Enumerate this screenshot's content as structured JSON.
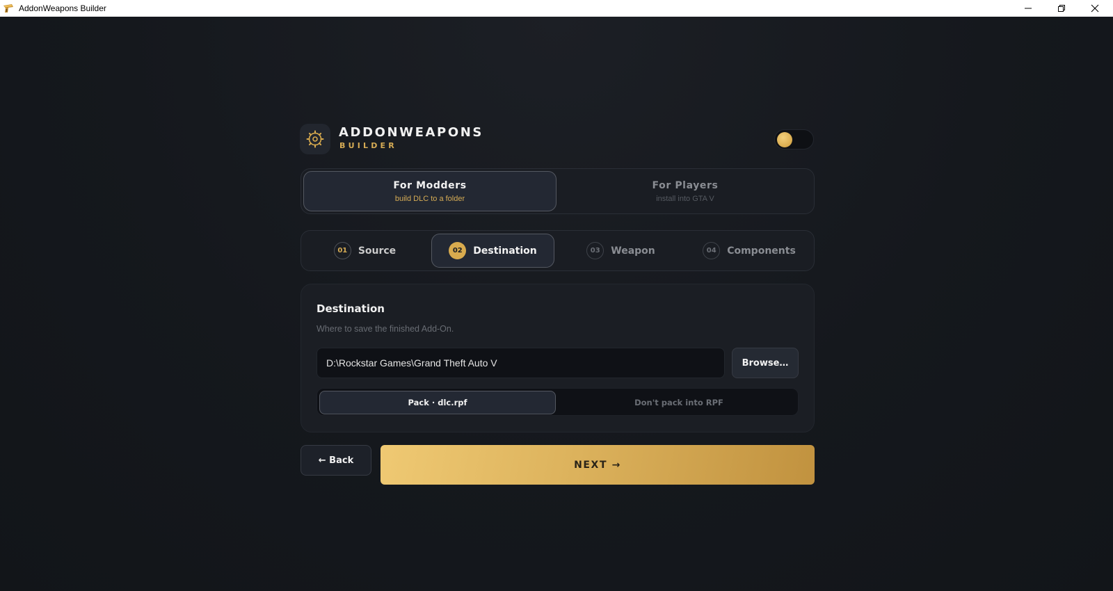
{
  "window": {
    "title": "AddonWeapons Builder",
    "app_icon": "pistol-icon",
    "controls": [
      "minimize-icon",
      "restore-icon",
      "close-icon"
    ]
  },
  "brand": {
    "name": "ADDONWEAPONS",
    "subtitle": "BUILDER",
    "logo_icon": "crosshair-gear-icon"
  },
  "theme_toggle": {
    "icon": "toggle-knob",
    "state": "on"
  },
  "mode": {
    "options": [
      {
        "label": "For Modders",
        "description": "build DLC to a folder",
        "selected": true
      },
      {
        "label": "For Players",
        "description": "install into GTA V",
        "selected": false
      }
    ]
  },
  "steps": [
    {
      "num": "01",
      "label": "Source",
      "state": "done"
    },
    {
      "num": "02",
      "label": "Destination",
      "state": "active"
    },
    {
      "num": "03",
      "label": "Weapon",
      "state": "todo"
    },
    {
      "num": "04",
      "label": "Components",
      "state": "todo"
    }
  ],
  "destination": {
    "title": "Destination",
    "description": "Where to save the finished Add-On.",
    "path_value": "D:\\Rockstar Games\\Grand Theft Auto V",
    "browse_label": "Browse…",
    "pack_options": [
      {
        "label": "Pack · dlc.rpf",
        "selected": true
      },
      {
        "label": "Don't pack into RPF",
        "selected": false
      }
    ]
  },
  "actions": {
    "back_label": "← Back",
    "next_label": "NEXT →"
  },
  "colors": {
    "accent": "#d9ab4e",
    "background": "#14171c",
    "panel": "#1a1d23"
  }
}
